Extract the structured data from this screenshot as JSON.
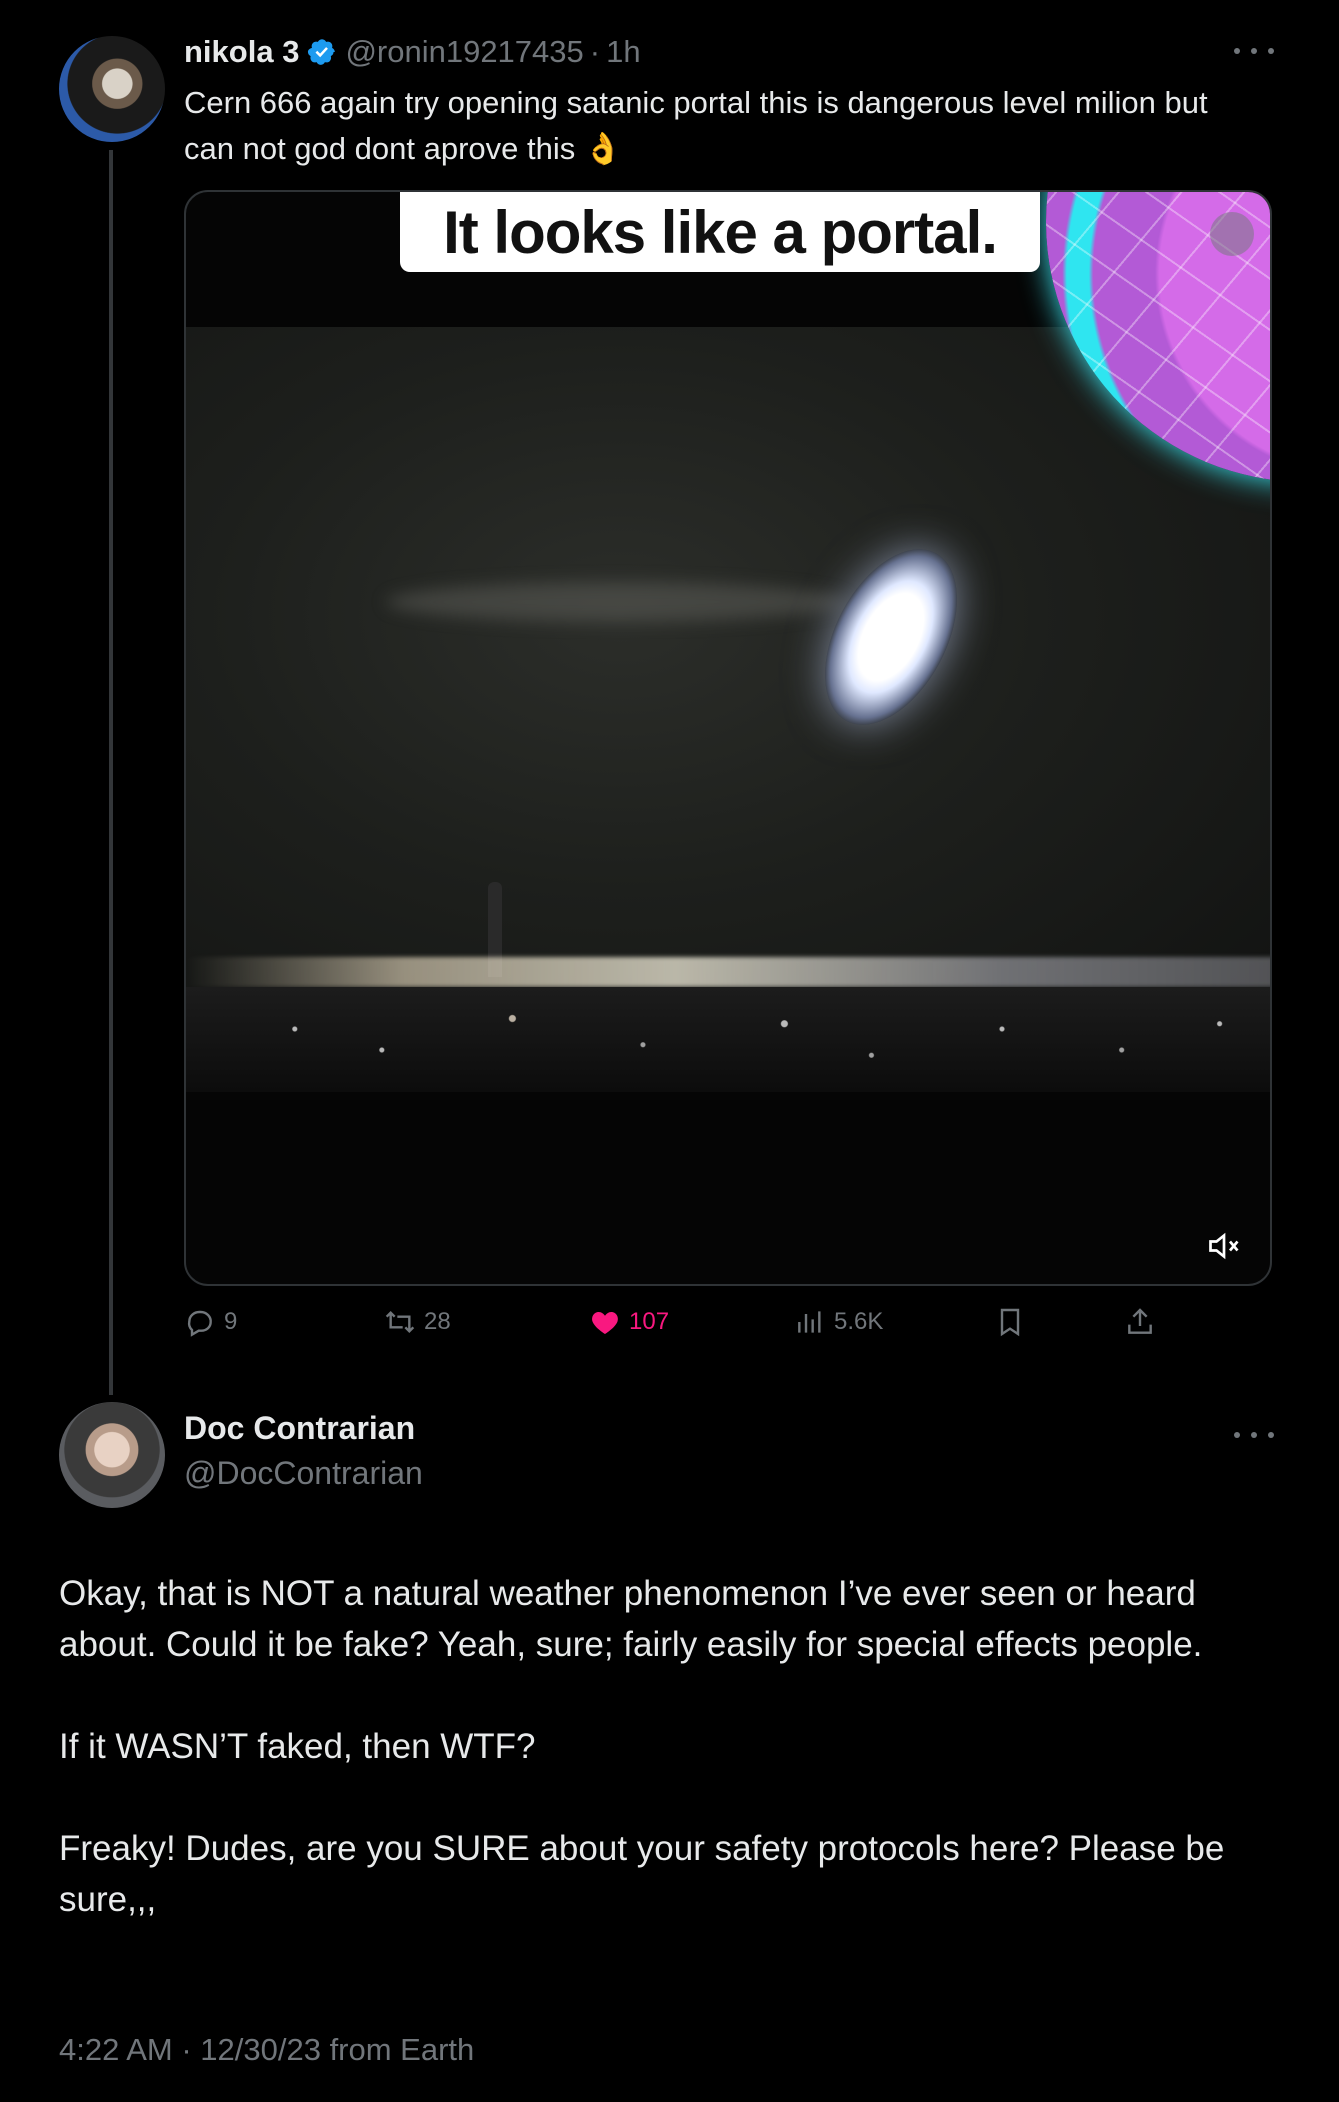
{
  "tweet1": {
    "author_name": "nikola 3",
    "handle": "@ronin19217435",
    "separator": "·",
    "time": "1h",
    "text": "Cern 666 again try opening satanic portal this is dangerous level milion but can not god dont aprove this 👌",
    "media": {
      "caption": "It looks like a portal."
    },
    "actions": {
      "replies": "9",
      "retweets": "28",
      "likes": "107",
      "views": "5.6K"
    },
    "colors": {
      "like_active": "#f91880",
      "verified_blue": "#1d9bf0",
      "secondary_text": "#71767b"
    }
  },
  "tweet2": {
    "author_name": "Doc Contrarian",
    "handle": "@DocContrarian",
    "paragraphs": [
      "Okay, that is NOT a natural weather phenomenon I’ve ever seen or heard about. Could it be fake? Yeah, sure; fairly easily for special effects people.",
      "If it WASN’T faked, then WTF?",
      "Freaky! Dudes, are you SURE about your safety protocols here? Please be sure,,,"
    ],
    "meta": "4:22 AM · 12/30/23 from Earth"
  }
}
